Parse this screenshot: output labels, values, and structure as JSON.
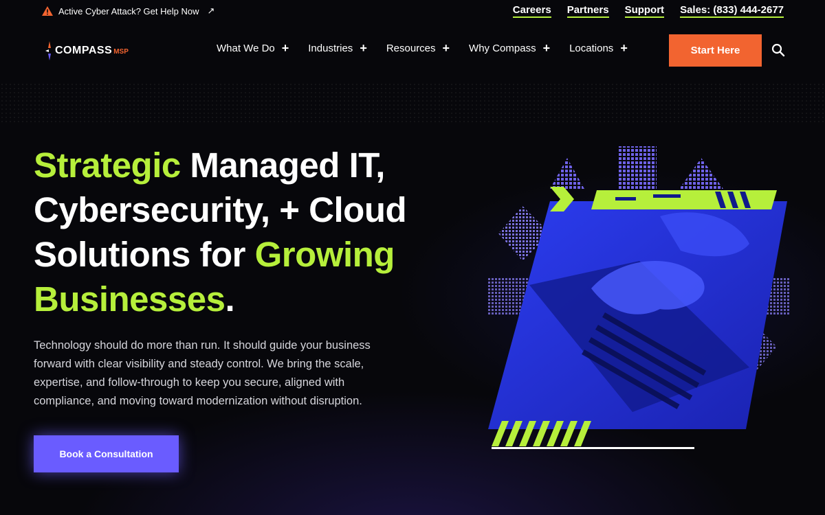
{
  "topbar": {
    "alert_text": "Active Cyber Attack? Get Help Now",
    "links": [
      {
        "label": "Careers"
      },
      {
        "label": "Partners"
      },
      {
        "label": "Support"
      },
      {
        "label": "Sales: (833) 444-2677"
      }
    ]
  },
  "nav": {
    "logo_text": "COMPASS",
    "logo_sub": "MSP",
    "menu": [
      {
        "label": "What We Do",
        "icon": "plus-icon"
      },
      {
        "label": "Industries",
        "icon": "plus-icon"
      },
      {
        "label": "Resources",
        "icon": "plus-icon"
      },
      {
        "label": "Why Compass",
        "icon": "plus-icon"
      },
      {
        "label": "Locations",
        "icon": "plus-icon"
      }
    ],
    "cta_label": "Start Here",
    "search_icon": "search-icon"
  },
  "hero": {
    "headline": {
      "part1": "Strategic",
      "part2": " Managed IT, Cybersecurity, + Cloud Solutions for ",
      "part3": "Growing Businesses",
      "part4": "."
    },
    "body": "Technology should do more than run. It should guide your business forward with clear visibility and steady control. We bring the scale, expertise, and follow-through to keep you secure, aligned with compliance, and moving toward modernization without disruption.",
    "cta_label": "Book a Consultation"
  },
  "colors": {
    "accent_green": "#b6ef3b",
    "accent_orange": "#f26430",
    "accent_purple": "#6a5cff",
    "art_blue": "#2a3ae0"
  }
}
